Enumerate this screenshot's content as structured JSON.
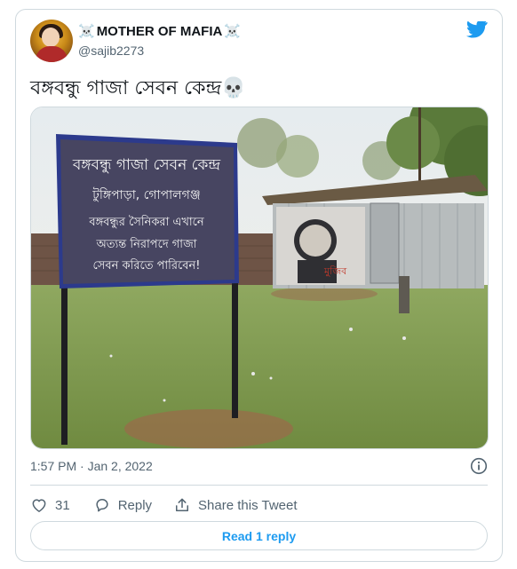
{
  "author": {
    "display_name": "MOTHER OF MAFIA",
    "name_prefix_emoji": "☠️",
    "name_suffix_emoji": "☠️",
    "handle": "@sajib2273",
    "avatar_icon": "avatar"
  },
  "brand": {
    "icon": "twitter-bird-icon",
    "color": "#1d9bf0"
  },
  "tweet": {
    "text": "বঙ্গবন্ধু গাজা সেবন কেন্দ্র💀",
    "media": {
      "sign_lines": [
        "বঙ্গবন্ধু গাজা সেবন কেন্দ্র",
        "টুঙ্গিপাড়া, গোপালগঞ্জ",
        "বঙ্গবন্ধুর সৈনিকরা এখানে",
        "অত্যন্ত নিরাপদে গাজা",
        "সেবন করিতে পারিবেন!"
      ],
      "wall_mural_text": "মুজিব"
    },
    "timestamp": "1:57 PM · Jan 2, 2022"
  },
  "actions": {
    "like_count": "31",
    "reply_label": "Reply",
    "share_label": "Share this Tweet"
  },
  "read_replies_label": "Read 1 reply",
  "colors": {
    "text_primary": "#0f1419",
    "text_secondary": "#536471",
    "border": "#cfd9de",
    "accent": "#1d9bf0"
  }
}
